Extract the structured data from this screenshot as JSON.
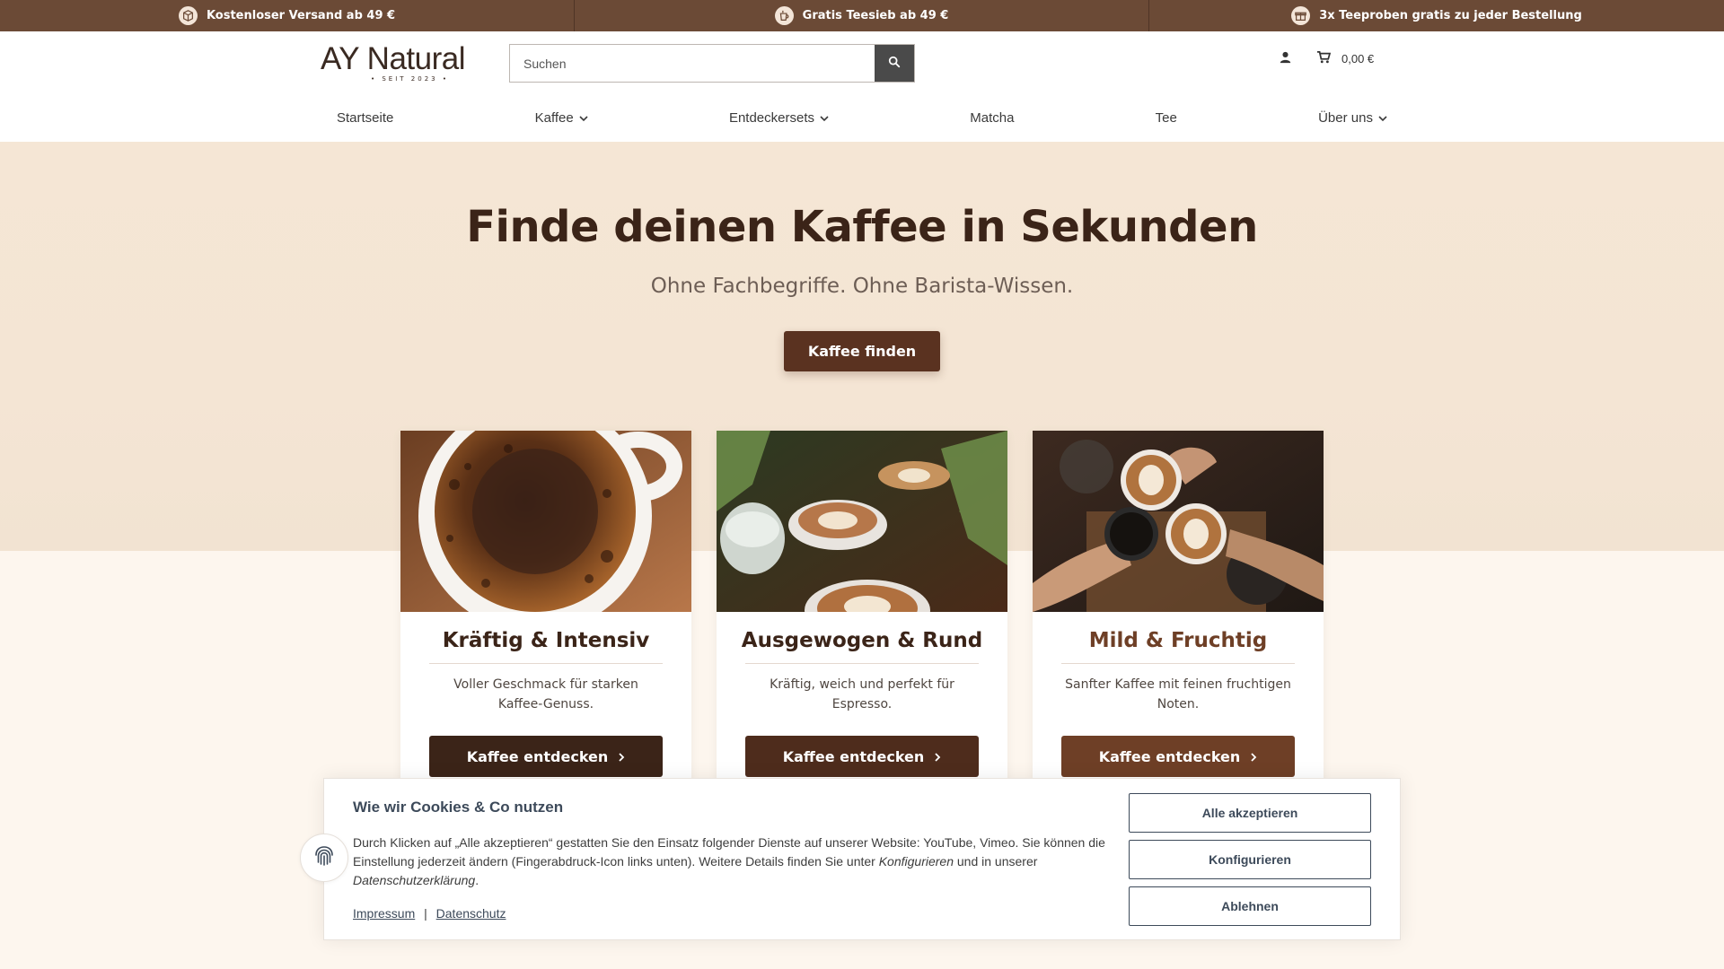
{
  "topbar": {
    "items": [
      {
        "icon": "box-icon",
        "label": "Kostenloser Versand ab 49 €"
      },
      {
        "icon": "tea-icon",
        "label": "Gratis Teesieb ab 49 €"
      },
      {
        "icon": "gift-icon",
        "label": "3x Teeproben gratis zu jeder Bestellung"
      }
    ]
  },
  "header": {
    "logo_text": "AY Natural",
    "logo_sub": "• SEIT 2023 •",
    "search_placeholder": "Suchen",
    "cart_total": "0,00 €"
  },
  "nav": {
    "items": [
      {
        "label": "Startseite",
        "dropdown": false
      },
      {
        "label": "Kaffee",
        "dropdown": true
      },
      {
        "label": "Entdeckersets",
        "dropdown": true
      },
      {
        "label": "Matcha",
        "dropdown": false
      },
      {
        "label": "Tee",
        "dropdown": false
      },
      {
        "label": "Über uns",
        "dropdown": true
      }
    ]
  },
  "hero": {
    "title": "Finde deinen Kaffee in Sekunden",
    "subtitle": "Ohne Fachbegriffe. Ohne Barista-Wissen.",
    "button": "Kaffee finden"
  },
  "cards": [
    {
      "title": "Kräftig & Intensiv",
      "text": "Voller Geschmack für starken Kaffee-Genuss.",
      "button": "Kaffee entdecken",
      "button_color": "#3b2418",
      "title_color": "#3b2418"
    },
    {
      "title": "Ausgewogen & Rund",
      "text": "Kräftig, weich und perfekt für Espresso.",
      "button": "Kaffee entdecken",
      "button_color": "#4e2c1c",
      "title_color": "#3b2418"
    },
    {
      "title": "Mild & Fruchtig",
      "text": "Sanfter Kaffee mit feinen fruchtigen Noten.",
      "button": "Kaffee entdecken",
      "button_color": "#6e3f26",
      "title_color": "#6e3f26"
    }
  ],
  "cookie": {
    "title": "Wie wir Cookies & Co nutzen",
    "text_part1": "Durch Klicken auf „Alle akzeptieren“ gestatten Sie den Einsatz folgender Dienste auf unserer Website: YouTube, Vimeo. Sie können die Einstellung jederzeit ändern (Fingerabdruck-Icon links unten). Weitere Details finden Sie unter ",
    "text_em1": "Konfigurieren",
    "text_part2": " und in unserer ",
    "text_em2": "Datenschutzerklärung",
    "text_part3": ".",
    "link_impressum": "Impressum",
    "link_sep": "|",
    "link_datenschutz": "Datenschutz",
    "btn_accept": "Alle akzeptieren",
    "btn_config": "Konfigurieren",
    "btn_reject": "Ablehnen"
  },
  "colors": {
    "topbar": "#6b4a36",
    "hero_bg": "#f4e5d4",
    "primary_brown": "#5a3220",
    "cookie_text": "#3d4a5a"
  }
}
